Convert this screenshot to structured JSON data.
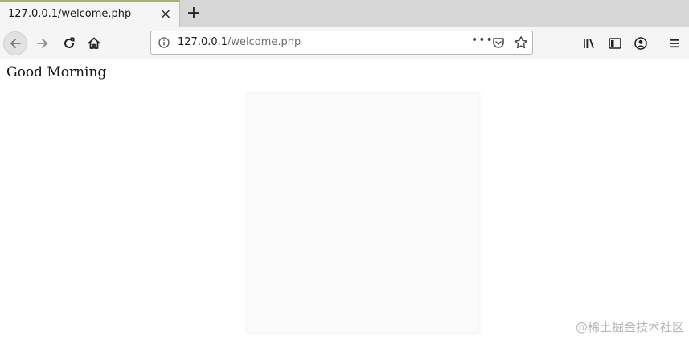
{
  "tab": {
    "title": "127.0.0.1/welcome.php"
  },
  "urlbar": {
    "host": "127.0.0.1",
    "path": "/welcome.php",
    "more": "•••"
  },
  "page": {
    "greeting": "Good Morning"
  },
  "watermark": "@稀土掘金技术社区",
  "icons": {
    "tab_close": "close-icon",
    "new_tab": "plus-icon",
    "back": "arrow-left-icon",
    "forward": "arrow-right-icon",
    "reload": "reload-icon",
    "home": "home-icon",
    "site_info": "info-icon",
    "pocket": "pocket-icon",
    "bookmark": "star-icon",
    "library": "library-icon",
    "sidebar": "sidebar-icon",
    "account": "account-icon",
    "menu": "hamburger-menu-icon"
  }
}
